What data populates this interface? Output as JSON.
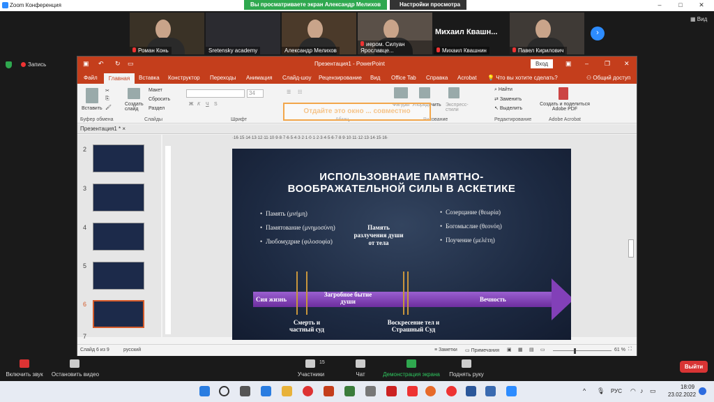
{
  "zoom": {
    "window_title": "Zoom Конференция",
    "share_banner": "Вы просматриваете экран Александр Мелихов",
    "view_options": "Настройки просмотра",
    "view_button": "Вид",
    "recording": "Запись",
    "participants": [
      {
        "name": "Роман Конь"
      },
      {
        "name": "Sretensky academy"
      },
      {
        "name": "Александр Мелихов"
      },
      {
        "name": "иером. Силуан Ярославце..."
      },
      {
        "name": "Михаил Квашнин",
        "big_label": "Михаил Квашн..."
      },
      {
        "name": "Павел Кирилович"
      }
    ],
    "toolbar": {
      "mute": "Включить звук",
      "video": "Остановить видео",
      "participants": "Участники",
      "participants_count": "15",
      "chat": "Чат",
      "share": "Демонстрация экрана",
      "raise_hand": "Поднять руку",
      "leave": "Выйти"
    }
  },
  "ppt": {
    "title": "Презентация1  -  PowerPoint",
    "login": "Вход",
    "tabs": [
      "Файл",
      "Главная",
      "Вставка",
      "Конструктор",
      "Переходы",
      "Анимация",
      "Слайд-шоу",
      "Рецензирование",
      "Вид",
      "Office Tab",
      "Справка",
      "Acrobat"
    ],
    "tell_me": "Что вы хотите сделать?",
    "share": "Общий доступ",
    "ribbon": {
      "paste": "Вставить",
      "create_slide": "Создать слайд",
      "layout": "Макет",
      "reset": "Сбросить",
      "section": "Раздел",
      "font_size": "34",
      "figures": "Фигуры",
      "arrange": "Упорядочить",
      "express_styles": "Экспресс-стили",
      "find": "Найти",
      "replace": "Заменить",
      "select": "Выделить",
      "create_pdf": "Создать и поделиться Adobe PDF",
      "groups": {
        "clipboard": "Буфер обмена",
        "slides": "Слайды",
        "font": "Шрифт",
        "paragraph": "Абзац",
        "drawing": "Рисование",
        "editing": "Редактирование",
        "acrobat": "Adobe Acrobat"
      },
      "overlay": "Отдайте это окно ... совместно"
    },
    "doc_tab": "Презентация1 *",
    "thumb_numbers": [
      "2",
      "3",
      "4",
      "5",
      "6",
      "7"
    ],
    "ruler_h": "·16·15·14·13·12·11·10·9·8·7·6·5·4·3·2·1·0·1·2·3·4·5·6·7·8·9·10·11·12·13·14·15·16·",
    "status": {
      "slide": "Слайд 6 из 9",
      "lang": "русский",
      "notes": "Заметки",
      "comments": "Примечания",
      "zoom": "61 %"
    },
    "slide": {
      "title_line1": "ИСПОЛЬЗОВНАИЕ ПАМЯТНО-",
      "title_line2": "ВООБРАЖАТЕЛЬНОЙ СИЛЫ В АСКЕТИКЕ",
      "left_bullets": [
        "Память (μνήμη)",
        "Памятование (μνημοσύνη)",
        "Любомудрие (φιλοσοφία)"
      ],
      "center_text": "Память разлучения души от тела",
      "right_bullets": [
        "Созерцание (θεωρία)",
        "Богомыслие (θεονόη)",
        "Поучение (μελέτη)"
      ],
      "arrow_labels": {
        "this_life": "Сия жизнь",
        "afterlife": "Загробное бытие души",
        "eternity": "Вечность"
      },
      "below_labels": {
        "death": "Смерть и частный суд",
        "resurrection": "Воскресение тел и Страшный Суд"
      }
    }
  },
  "taskbar": {
    "lang": "РУС",
    "time": "18:09",
    "date": "23.02.2022"
  }
}
